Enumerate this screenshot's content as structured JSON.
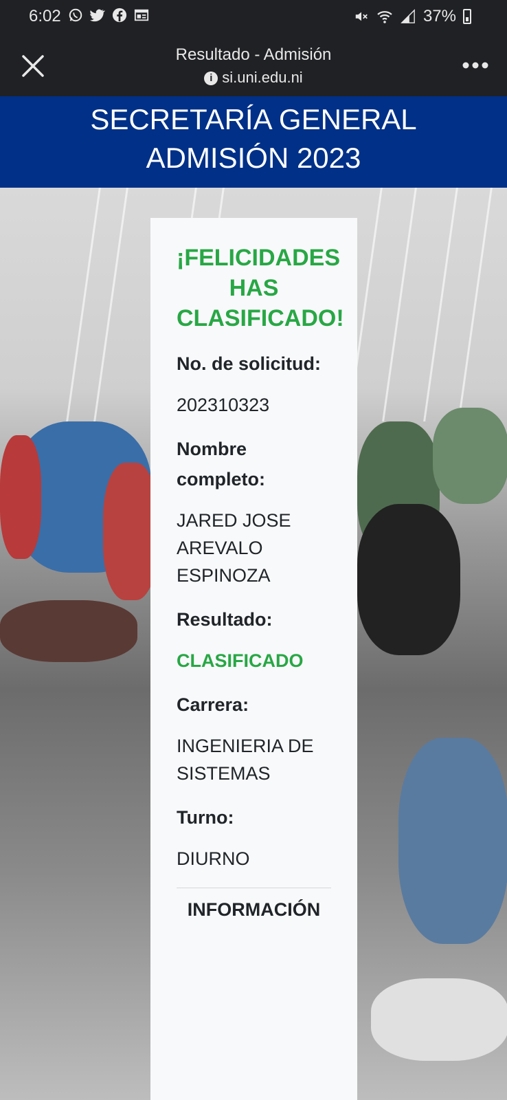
{
  "status_bar": {
    "time": "6:02",
    "battery": "37%",
    "notification_icons": [
      "whatsapp-icon",
      "twitter-icon",
      "facebook-icon",
      "news-icon"
    ],
    "system_icons": [
      "mute-icon",
      "wifi-icon",
      "signal-icon",
      "battery-icon"
    ]
  },
  "browser": {
    "title": "Resultado - Admisión",
    "url": "si.uni.edu.ni",
    "close_icon": "close-icon",
    "menu_icon": "more-icon"
  },
  "banner": {
    "line1": "SECRETARÍA GENERAL",
    "line2": "ADMISIÓN 2023",
    "color": "#003087"
  },
  "result": {
    "heading": "¡FELICIDADES HAS CLASIFICADO!",
    "request_label": "No. de solicitud:",
    "request_value": "202310323",
    "name_label": "Nombre completo:",
    "name_value": "JARED JOSE AREVALO ESPINOZA",
    "result_label": "Resultado:",
    "result_value": "CLASIFICADO",
    "career_label": "Carrera:",
    "career_value": "INGENIERIA DE SISTEMAS",
    "shift_label": "Turno:",
    "shift_value": "DIURNO",
    "more_info": "INFORMACIÓN",
    "accent_color": "#28a745"
  }
}
